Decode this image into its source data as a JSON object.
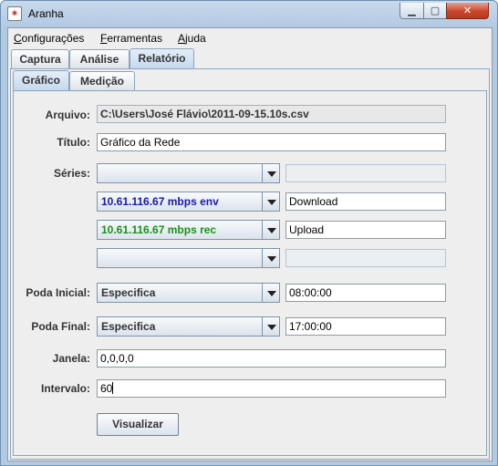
{
  "window": {
    "title": "Aranha",
    "icon": "spider-app-icon"
  },
  "menubar": {
    "items": [
      {
        "mnemonic": "C",
        "rest": "onfigurações"
      },
      {
        "mnemonic": "F",
        "rest": "erramentas"
      },
      {
        "mnemonic": "A",
        "rest": "juda"
      }
    ]
  },
  "tabs_top": [
    "Captura",
    "Análise",
    "Relatório"
  ],
  "tabs_top_selected": "Relatório",
  "tabs_inner": [
    "Gráfico",
    "Medição"
  ],
  "tabs_inner_selected": "Gráfico",
  "form": {
    "arquivo": {
      "label": "Arquivo:",
      "value": "C:\\Users\\José Flávio\\2011-09-15.10s.csv"
    },
    "titulo": {
      "label": "Título:",
      "value": "Gráfico da Rede"
    },
    "series": {
      "label": "Séries:",
      "rows": [
        {
          "selected": "",
          "name": ""
        },
        {
          "selected": "10.61.116.67 mbps env",
          "name": "Download",
          "color": "#1a1aa6"
        },
        {
          "selected": "10.61.116.67 mbps rec",
          "name": "Upload",
          "color": "#1e8f1e"
        },
        {
          "selected": "",
          "name": ""
        }
      ]
    },
    "poda_inicial": {
      "label": "Poda Inicial:",
      "selected": "Especifica",
      "time": "08:00:00"
    },
    "poda_final": {
      "label": "Poda Final:",
      "selected": "Especifica",
      "time": "17:00:00"
    },
    "janela": {
      "label": "Janela:",
      "value": "0,0,0,0"
    },
    "intervalo": {
      "label": "Intervalo:",
      "value": "60"
    },
    "visualizar_label": "Visualizar"
  }
}
